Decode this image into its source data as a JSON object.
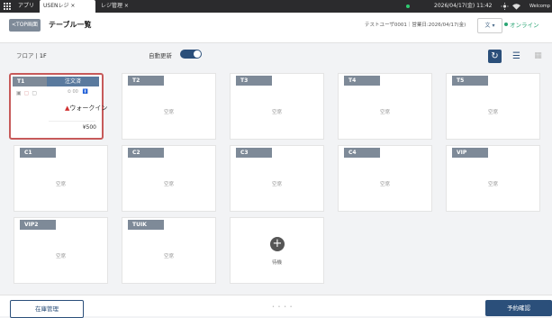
{
  "sysbar": {
    "apps_label": "アプリ",
    "tab_usen": "USENレジ ×",
    "tab_register": "レジ管理 ×",
    "datetime": "2026/04/17(金) 11:42",
    "right_label": "Welcomp"
  },
  "header": {
    "back_label": "TOP画面",
    "title": "テーブル一覧",
    "user_info": "テストユーザ0001｜営業日:2026/04/17(金)",
    "lang_label": "文 ▾",
    "status_label": "オンライン"
  },
  "subbar": {
    "floor_label": "フロア",
    "floor_value": "1F",
    "auto_update_label": "自動更新",
    "auto_update_on": true
  },
  "tables": [
    {
      "name": "T1",
      "active": true,
      "ordered_label": "注文済",
      "time": "00",
      "customer": "ウォークイン",
      "amount": "¥500"
    },
    {
      "name": "T2",
      "status": "空席"
    },
    {
      "name": "T3",
      "status": "空席"
    },
    {
      "name": "T4",
      "status": "空席"
    },
    {
      "name": "T5",
      "status": "空席"
    },
    {
      "name": "C1",
      "status": "空席"
    },
    {
      "name": "C2",
      "status": "空席"
    },
    {
      "name": "C3",
      "status": "空席"
    },
    {
      "name": "C4",
      "status": "空席"
    },
    {
      "name": "VIP",
      "status": "空席"
    },
    {
      "name": "VIP2",
      "status": "空席"
    },
    {
      "name": "TUIK",
      "status": "空席"
    }
  ],
  "add_card": {
    "label": "待機"
  },
  "footer": {
    "inventory_label": "在庫管理",
    "pager": "• • • •",
    "reservation_label": "予約確認"
  },
  "colors": {
    "accent": "#2b4f7a",
    "tag": "#7e8a98",
    "highlight": "#c75a5a",
    "online": "#2aa574"
  }
}
